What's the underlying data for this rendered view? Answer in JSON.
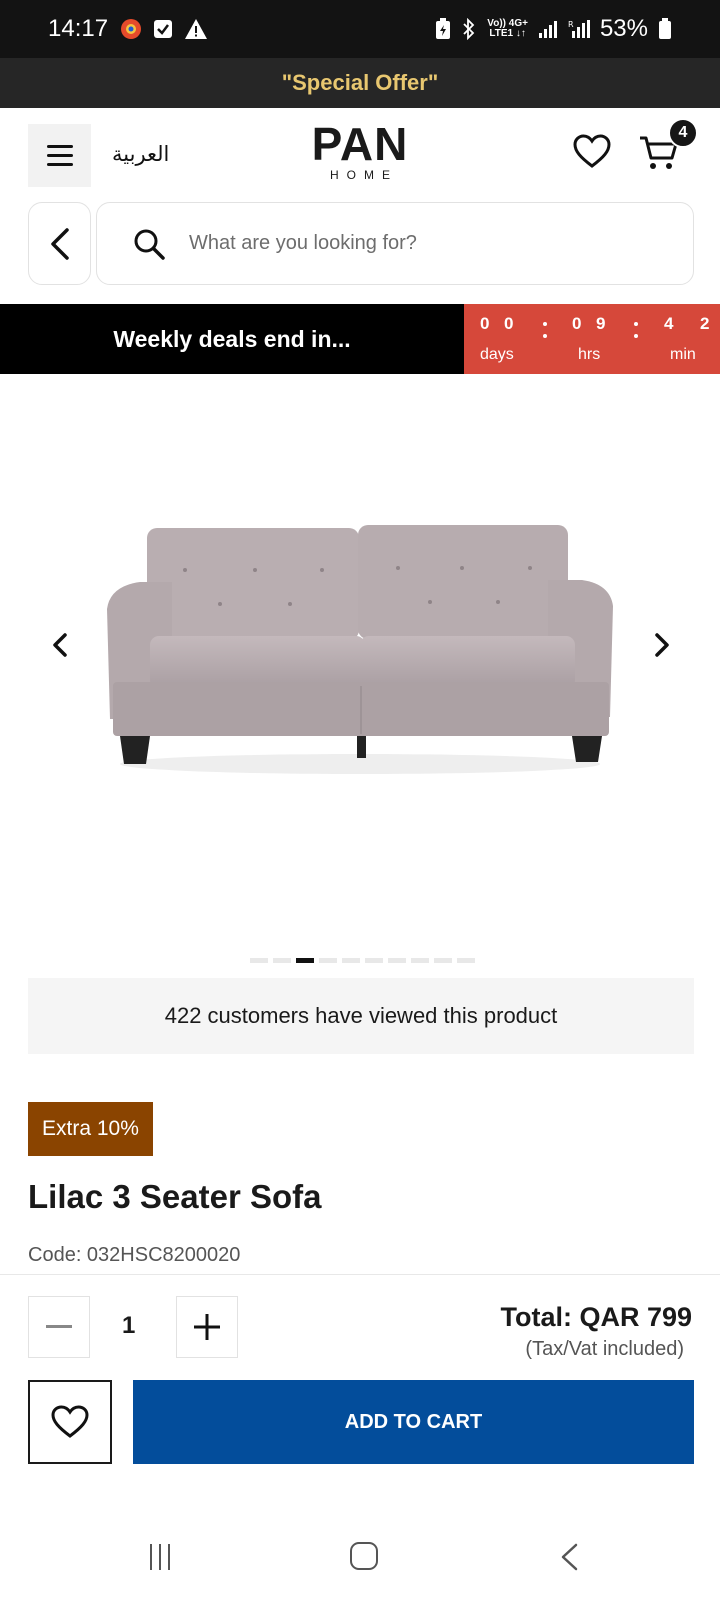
{
  "status_bar": {
    "time": "14:17",
    "battery": "53%",
    "net_top": "Vo)) 4G+",
    "net_bottom": "LTE1 ↓↑"
  },
  "promo": {
    "text": "\"Special Offer\""
  },
  "header": {
    "language_link": "العربية",
    "logo_main": "PAN",
    "logo_sub": "HOME",
    "cart_count": "4"
  },
  "search": {
    "placeholder": "What are you looking for?"
  },
  "deals": {
    "label": "Weekly deals end in...",
    "days_digits": [
      "0",
      "0"
    ],
    "hrs_digits": [
      "0",
      "9"
    ],
    "min_digits": [
      "4",
      "2"
    ],
    "units": {
      "days": "days",
      "hrs": "hrs",
      "min": "min"
    }
  },
  "carousel": {
    "image_count": 10,
    "active_index": 2
  },
  "viewed": {
    "text": "422 customers have viewed this product"
  },
  "product": {
    "badge": "Extra 10%",
    "title": "Lilac 3 Seater Sofa",
    "code": "Code: 032HSC8200020"
  },
  "purchase": {
    "quantity": "1",
    "total": "Total: QAR 799",
    "tax_note": "(Tax/Vat included)",
    "add_to_cart_label": "ADD TO CART"
  },
  "colors": {
    "promo_text": "#e8c770",
    "countdown_bg": "#d6483a",
    "badge_bg": "#8a4400",
    "cta_bg": "#034d9b"
  }
}
